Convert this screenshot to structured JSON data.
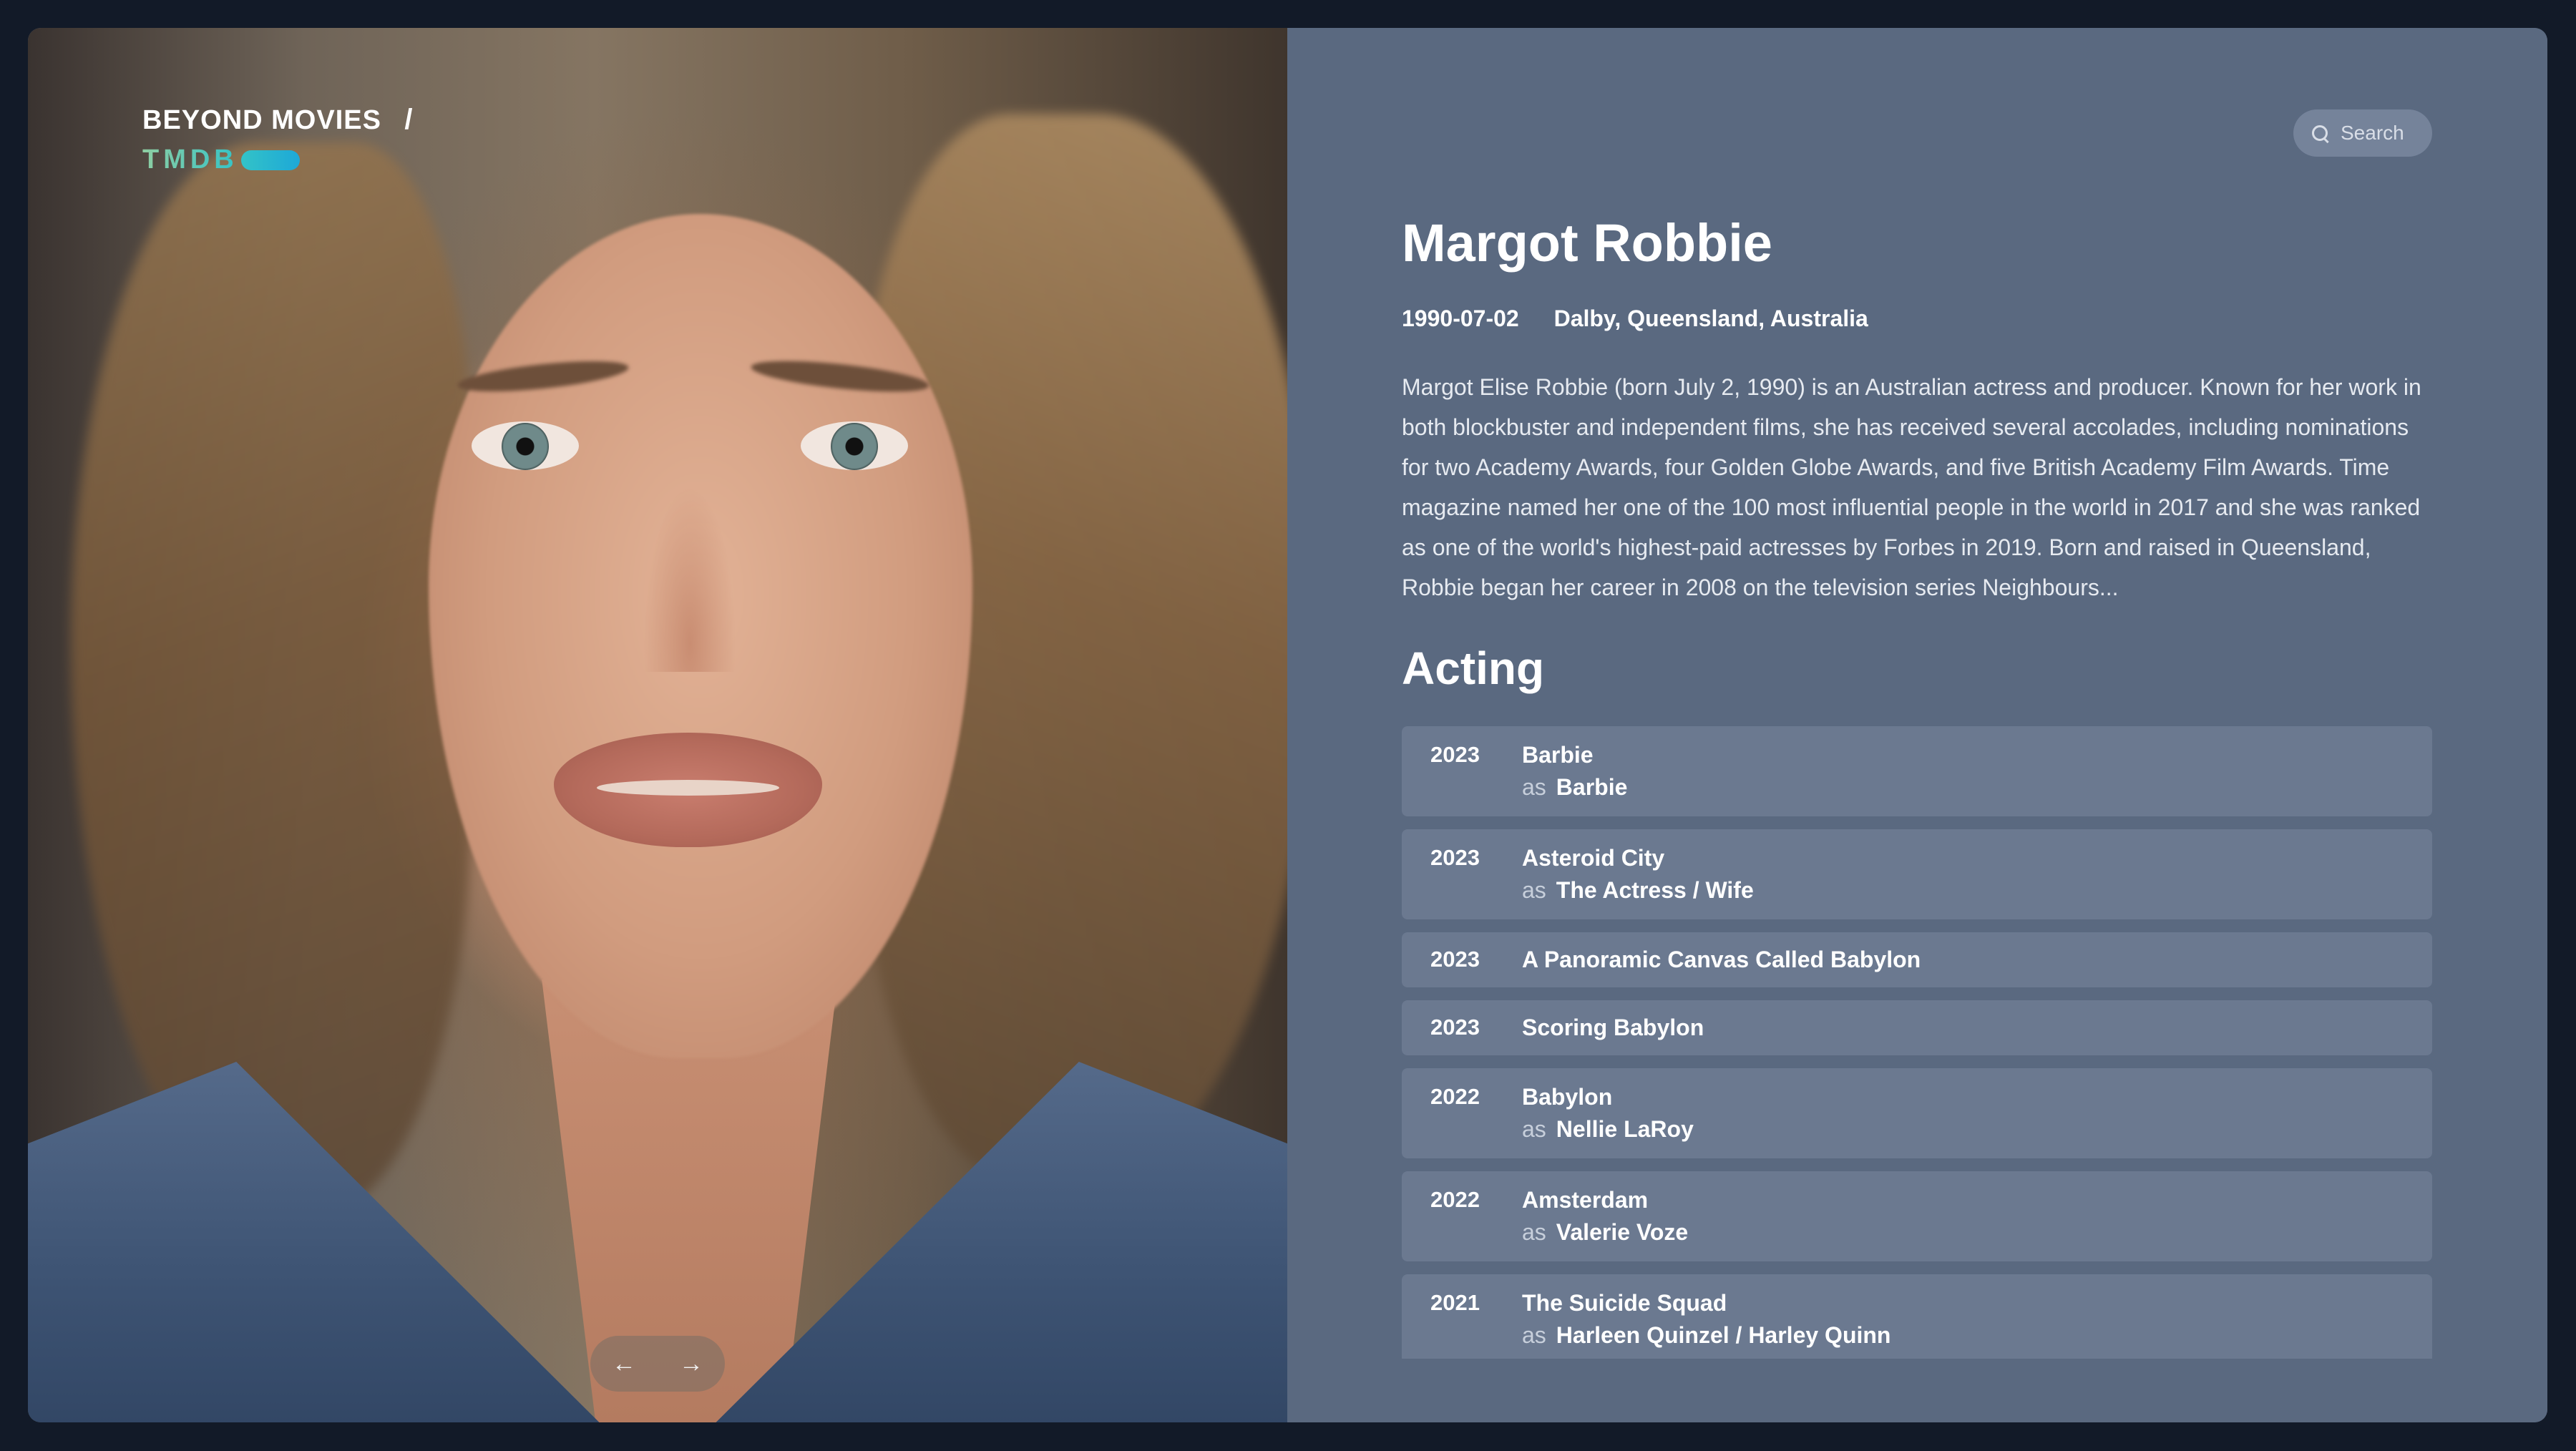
{
  "brand": {
    "title": "BEYOND MOVIES",
    "separator": "/",
    "sub": "TMDB"
  },
  "gallery": {
    "prev_icon": "arrow-left-icon",
    "next_icon": "arrow-right-icon",
    "prev_glyph": "←",
    "next_glyph": "→"
  },
  "search": {
    "label": "Search"
  },
  "person": {
    "name": "Margot Robbie",
    "birthday": "1990-07-02",
    "birthplace": "Dalby, Queensland, Australia",
    "bio": "Margot Elise Robbie (born July 2, 1990) is an Australian actress and producer. Known for her work in both blockbuster and independent films, she has received several accolades, including nominations for two Academy Awards, four Golden Globe Awards, and five British Academy Film Awards. Time magazine named her one of the 100 most influential people in the world in 2017 and she was ranked as one of the world's highest-paid actresses by Forbes in 2019. Born and raised in Queensland, Robbie began her career in 2008 on the television series Neighbours..."
  },
  "acting": {
    "title": "Acting",
    "as_label": "as",
    "credits": [
      {
        "year": "2023",
        "title": "Barbie",
        "role": "Barbie"
      },
      {
        "year": "2023",
        "title": "Asteroid City",
        "role": "The Actress / Wife"
      },
      {
        "year": "2023",
        "title": "A Panoramic Canvas Called Babylon",
        "role": ""
      },
      {
        "year": "2023",
        "title": "Scoring Babylon",
        "role": ""
      },
      {
        "year": "2022",
        "title": "Babylon",
        "role": "Nellie LaRoy"
      },
      {
        "year": "2022",
        "title": "Amsterdam",
        "role": "Valerie Voze"
      },
      {
        "year": "2021",
        "title": "The Suicide Squad",
        "role": "Harleen Quinzel / Harley Quinn"
      }
    ]
  },
  "colors": {
    "background": "#121a28",
    "panel": "#5a6980",
    "card": "#6b7990",
    "accent": "#33c3c7"
  }
}
